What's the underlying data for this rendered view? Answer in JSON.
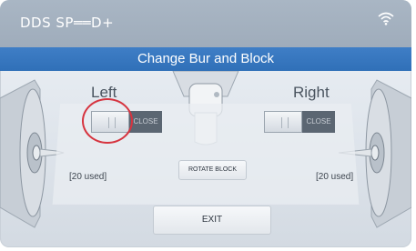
{
  "header": {
    "brand": "DDS SP══D+",
    "wifi_icon": "wifi-icon"
  },
  "title": "Change Bur and Block",
  "left": {
    "label": "Left",
    "toggle_off_label": "CLOSE",
    "used": "[20 used]"
  },
  "right": {
    "label": "Right",
    "toggle_off_label": "CLOSE",
    "used": "[20 used]"
  },
  "buttons": {
    "rotate_block": "ROTATE BLOCK",
    "exit": "EXIT"
  },
  "colors": {
    "title_bar": "#3070b8",
    "highlight_ring": "#d6343f"
  }
}
